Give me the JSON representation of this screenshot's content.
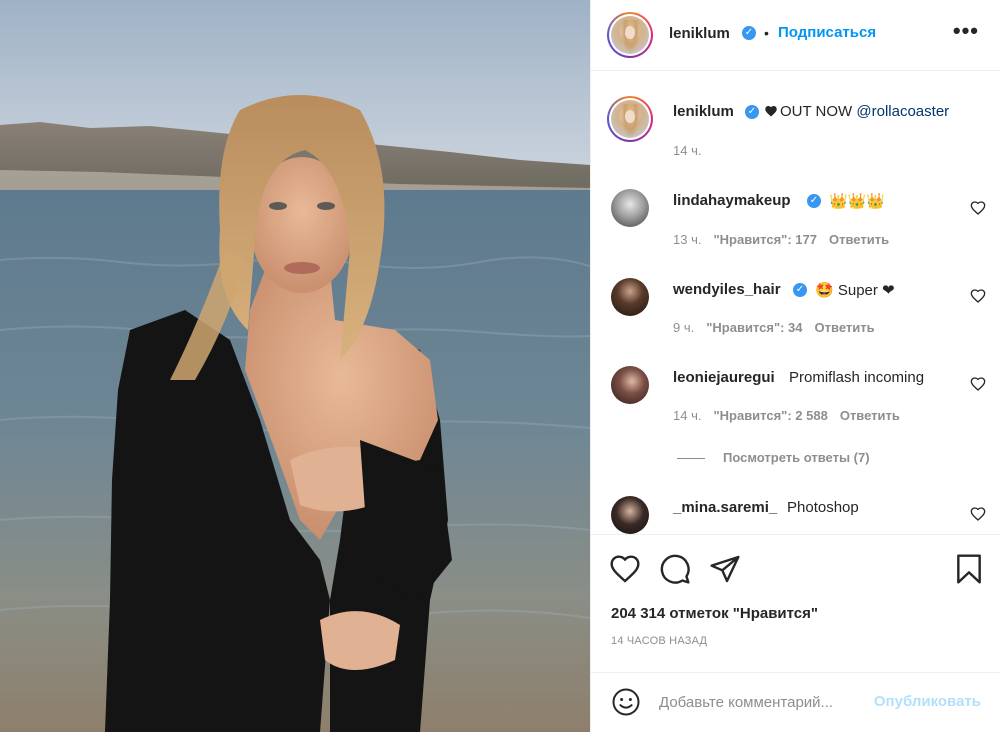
{
  "post": {
    "author": "leniklum",
    "follow_label": "Подписаться",
    "separator": "•",
    "more_label": "•••",
    "caption": {
      "text": "OUT NOW",
      "mention": "@rollacoaster",
      "time": "14 ч."
    }
  },
  "comments": [
    {
      "user": "lindahaymakeup",
      "verified": true,
      "text": "👑👑👑",
      "time": "13 ч.",
      "likes": "\"Нравится\": 177",
      "reply": "Ответить"
    },
    {
      "user": "wendyiles_hair",
      "verified": true,
      "text": "🤩 Super ❤",
      "time": "9 ч.",
      "likes": "\"Нравится\": 34",
      "reply": "Ответить"
    },
    {
      "user": "leoniejauregui",
      "verified": false,
      "text": "Promiflash incoming",
      "time": "14 ч.",
      "likes": "\"Нравится\": 2 588",
      "reply": "Ответить",
      "view_replies": "Посмотреть ответы (7)"
    },
    {
      "user": "_mina.saremi_",
      "verified": false,
      "text": "Photoshop"
    }
  ],
  "footer": {
    "likes_count": "204 314 отметок \"Нравится\"",
    "time_ago": "14 ЧАСОВ НАЗАД",
    "comment_placeholder": "Добавьте комментарий...",
    "publish_label": "Опубликовать"
  },
  "icons": {
    "like": "heart-outline-icon",
    "comment": "comment-bubble-icon",
    "share": "paper-plane-icon",
    "save": "bookmark-icon",
    "emoji": "smiley-icon",
    "verified": "verified-badge-icon",
    "more": "more-dots-icon"
  },
  "colors": {
    "link_blue": "#0095f6",
    "verified_blue": "#3897f0",
    "muted_gray": "#8e8e8e",
    "publish_disabled": "#b2dffc"
  }
}
